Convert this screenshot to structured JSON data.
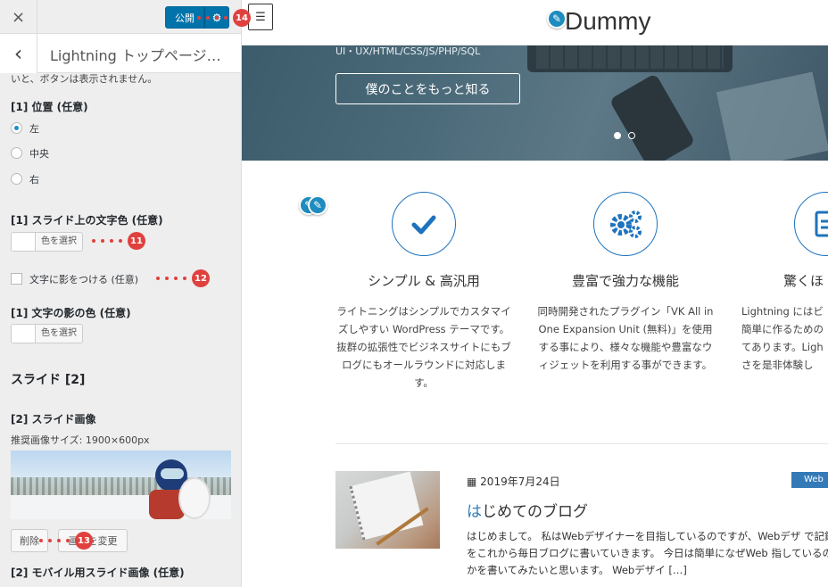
{
  "sidebar": {
    "close_icon": "×",
    "publish_label": "公開",
    "gear_icon": "⚙",
    "back_icon": "‹",
    "title": "Lightning トップページ…",
    "truncated_note": "いと、ボタンは表示されません。",
    "position_label": "[1] 位置 (任意)",
    "position_options": [
      "左",
      "中央",
      "右"
    ],
    "text_color_label": "[1] スライド上の文字色 (任意)",
    "select_color": "色を選択",
    "shadow_checkbox_label": "文字に影をつける (任意)",
    "shadow_color_label": "[1] 文字の影の色 (任意)",
    "slide2_heading": "スライド [2]",
    "slide_image_label": "[2] スライド画像",
    "recommended_size": "推奨画像サイズ: 1900×600px",
    "delete_button": "削除",
    "change_image_button": "画像を変更",
    "mobile_image_label": "[2] モバイル用スライド画像 (任意)"
  },
  "annotations": {
    "a11": "11",
    "a12": "12",
    "a13": "13",
    "a14": "14"
  },
  "preview": {
    "menu_icon": "☰",
    "site_title": "Dummy",
    "hero_subtitle": "UI・UX/HTML/CSS/JS/PHP/SQL",
    "hero_button": "僕のことをもっと知る",
    "features": [
      {
        "title": "シンプル & 高汎用",
        "desc": "ライトニングはシンプルでカスタマイズしやすい WordPress テーマです。抜群の拡張性でビジネスサイトにもブログにもオールラウンドに対応します。"
      },
      {
        "title": "豊富で強力な機能",
        "desc": "同時開発されたプラグイン「VK All in One Expansion Unit (無料)」を使用する事により、様々な機能や豊富なウィジェットを利用する事ができます。"
      },
      {
        "title": "驚くほ",
        "desc": "Lightning にはビ簡単に作るための てあります。Ligh さを是非体験し"
      }
    ],
    "post": {
      "date_icon": "▦",
      "date": "2019年7月24日",
      "category": "Web",
      "title_first": "は",
      "title_rest": "じめてのブログ",
      "excerpt": "はじめまして。 私はWebデザイナーを目指しているのですが、Webデザ で記録をこれから毎日ブログに書いていきます。 今日は簡単になぜWeb 指しているのかを書いてみたいと思います。 Webデザイ […]"
    }
  }
}
